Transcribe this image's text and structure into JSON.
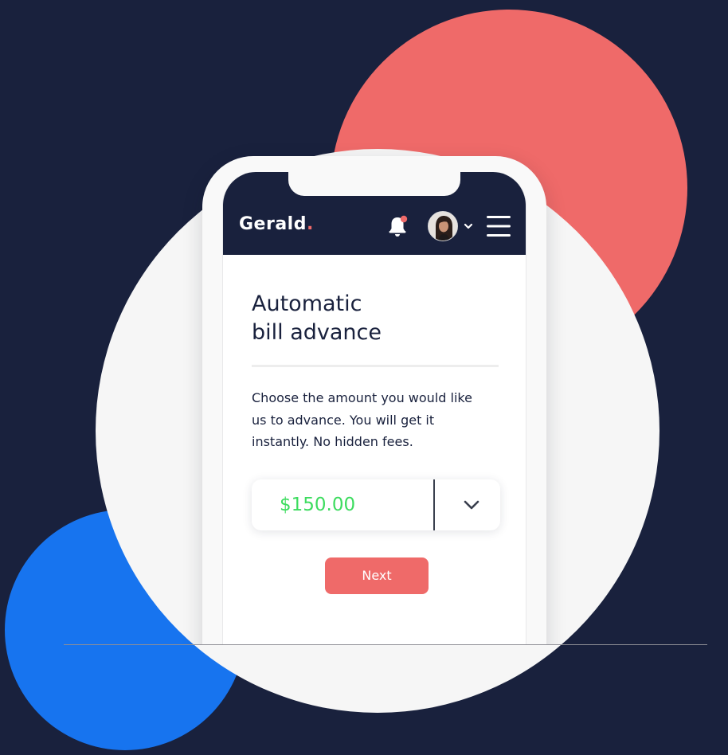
{
  "brand": {
    "name": "Gerald",
    "dot": ".",
    "accent_color": "#ef6a69",
    "navy_color": "#19213d",
    "blue_color": "#1774ef"
  },
  "header": {
    "notification_icon": "bell-icon",
    "avatar_icon": "user-avatar",
    "avatar_menu_icon": "chevron-down-icon",
    "menu_icon": "hamburger-menu-icon"
  },
  "card": {
    "title_line1": "Automatic",
    "title_line2": "bill advance",
    "description": "Choose the amount you would like us to advance. You will get it instantly. No hidden fees.",
    "amount": "$150.00",
    "amount_color": "#3ddc5f",
    "next_label": "Next"
  }
}
